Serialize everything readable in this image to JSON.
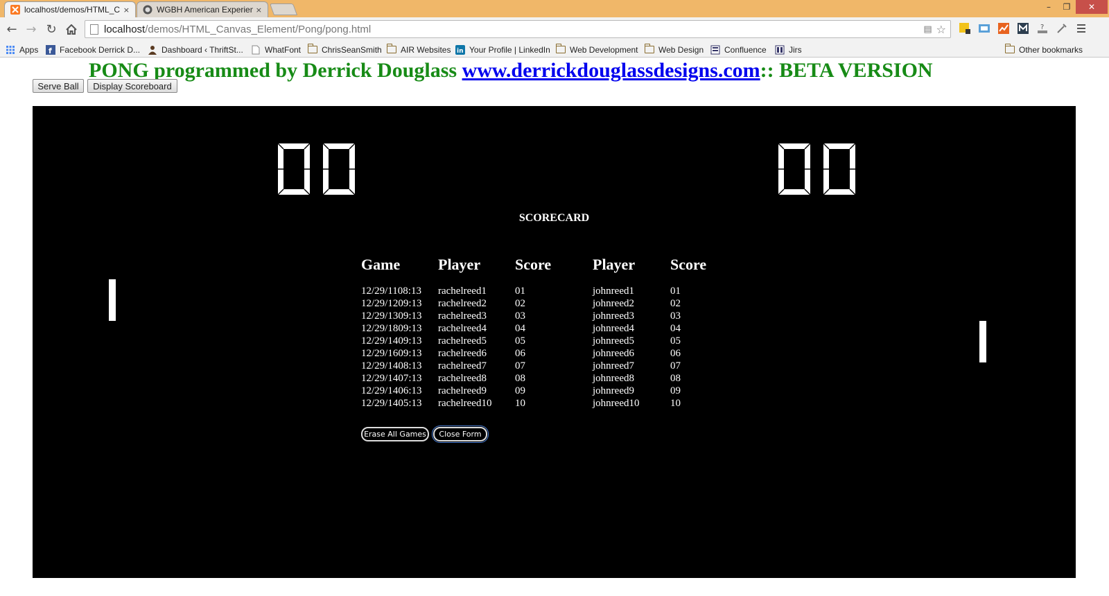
{
  "browser": {
    "tabs": [
      {
        "title": "localhost/demos/HTML_C",
        "close": "×"
      },
      {
        "title": "WGBH American Experien",
        "close": "×"
      }
    ],
    "window_controls": [
      "–",
      "❐",
      "✕"
    ],
    "url_host": "localhost",
    "url_path": "/demos/HTML_Canvas_Element/Pong/pong.html",
    "bookmarks": [
      {
        "label": "Apps",
        "icon": "apps-grid-icon"
      },
      {
        "label": "Facebook Derrick D...",
        "icon": "facebook-icon"
      },
      {
        "label": "Dashboard ‹ ThriftSt...",
        "icon": "person-icon"
      },
      {
        "label": "WhatFont",
        "icon": "page-icon"
      },
      {
        "label": "ChrisSeanSmith",
        "icon": "folder-icon"
      },
      {
        "label": "AIR Websites",
        "icon": "folder-icon"
      },
      {
        "label": "Your Profile | LinkedIn",
        "icon": "linkedin-icon"
      },
      {
        "label": "Web Development",
        "icon": "folder-icon"
      },
      {
        "label": "Web Design",
        "icon": "folder-icon"
      },
      {
        "label": "Confluence",
        "icon": "confluence-icon"
      },
      {
        "label": "Jirs",
        "icon": "jira-icon"
      }
    ],
    "other_bookmarks": "Other bookmarks",
    "colors": {
      "tabstrip": "#f0b769",
      "toolbar": "#f2f2f2"
    }
  },
  "page": {
    "headline_prefix": "PONG programmed by Derrick Douglass ",
    "headline_link": "www.derrickdouglassdesigns.com",
    "headline_suffix": ":: BETA VERSION",
    "serve_ball_label": "Serve Ball",
    "display_scoreboard_label": "Display Scoreboard",
    "colors": {
      "headline": "#178b16",
      "link": "#0000ee",
      "canvas": "#000000"
    }
  },
  "game": {
    "left_score": "00",
    "right_score": "00",
    "scorecard_title": "SCORECARD",
    "columns": [
      "Game",
      "Player",
      "Score",
      "Player",
      "Score"
    ],
    "rows": [
      [
        "12/29/1108:13",
        "rachelreed1",
        "01",
        "johnreed1",
        "01"
      ],
      [
        "12/29/1209:13",
        "rachelreed2",
        "02",
        "johnreed2",
        "02"
      ],
      [
        "12/29/1309:13",
        "rachelreed3",
        "03",
        "johnreed3",
        "03"
      ],
      [
        "12/29/1809:13",
        "rachelreed4",
        "04",
        "johnreed4",
        "04"
      ],
      [
        "12/29/1409:13",
        "rachelreed5",
        "05",
        "johnreed5",
        "05"
      ],
      [
        "12/29/1609:13",
        "rachelreed6",
        "06",
        "johnreed6",
        "06"
      ],
      [
        "12/29/1408:13",
        "rachelreed7",
        "07",
        "johnreed7",
        "07"
      ],
      [
        "12/29/1407:13",
        "rachelreed8",
        "08",
        "johnreed8",
        "08"
      ],
      [
        "12/29/1406:13",
        "rachelreed9",
        "09",
        "johnreed9",
        "09"
      ],
      [
        "12/29/1405:13",
        "rachelreed10",
        "10",
        "johnreed10",
        "10"
      ]
    ],
    "erase_label": "Erase  All Games",
    "close_label": "Close Form"
  }
}
